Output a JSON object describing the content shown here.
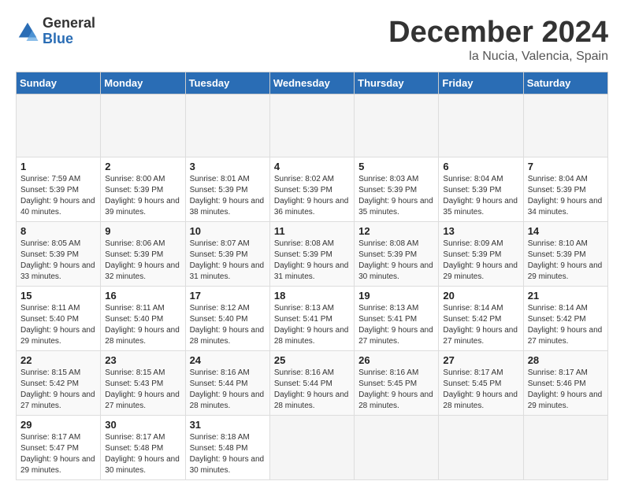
{
  "header": {
    "logo_general": "General",
    "logo_blue": "Blue",
    "month_title": "December 2024",
    "location": "la Nucia, Valencia, Spain"
  },
  "calendar": {
    "days_of_week": [
      "Sunday",
      "Monday",
      "Tuesday",
      "Wednesday",
      "Thursday",
      "Friday",
      "Saturday"
    ],
    "weeks": [
      [
        {
          "day": "",
          "empty": true
        },
        {
          "day": "",
          "empty": true
        },
        {
          "day": "",
          "empty": true
        },
        {
          "day": "",
          "empty": true
        },
        {
          "day": "",
          "empty": true
        },
        {
          "day": "",
          "empty": true
        },
        {
          "day": "",
          "empty": true
        }
      ],
      [
        {
          "day": "1",
          "sunrise": "Sunrise: 7:59 AM",
          "sunset": "Sunset: 5:39 PM",
          "daylight": "Daylight: 9 hours and 40 minutes."
        },
        {
          "day": "2",
          "sunrise": "Sunrise: 8:00 AM",
          "sunset": "Sunset: 5:39 PM",
          "daylight": "Daylight: 9 hours and 39 minutes."
        },
        {
          "day": "3",
          "sunrise": "Sunrise: 8:01 AM",
          "sunset": "Sunset: 5:39 PM",
          "daylight": "Daylight: 9 hours and 38 minutes."
        },
        {
          "day": "4",
          "sunrise": "Sunrise: 8:02 AM",
          "sunset": "Sunset: 5:39 PM",
          "daylight": "Daylight: 9 hours and 36 minutes."
        },
        {
          "day": "5",
          "sunrise": "Sunrise: 8:03 AM",
          "sunset": "Sunset: 5:39 PM",
          "daylight": "Daylight: 9 hours and 35 minutes."
        },
        {
          "day": "6",
          "sunrise": "Sunrise: 8:04 AM",
          "sunset": "Sunset: 5:39 PM",
          "daylight": "Daylight: 9 hours and 35 minutes."
        },
        {
          "day": "7",
          "sunrise": "Sunrise: 8:04 AM",
          "sunset": "Sunset: 5:39 PM",
          "daylight": "Daylight: 9 hours and 34 minutes."
        }
      ],
      [
        {
          "day": "8",
          "sunrise": "Sunrise: 8:05 AM",
          "sunset": "Sunset: 5:39 PM",
          "daylight": "Daylight: 9 hours and 33 minutes."
        },
        {
          "day": "9",
          "sunrise": "Sunrise: 8:06 AM",
          "sunset": "Sunset: 5:39 PM",
          "daylight": "Daylight: 9 hours and 32 minutes."
        },
        {
          "day": "10",
          "sunrise": "Sunrise: 8:07 AM",
          "sunset": "Sunset: 5:39 PM",
          "daylight": "Daylight: 9 hours and 31 minutes."
        },
        {
          "day": "11",
          "sunrise": "Sunrise: 8:08 AM",
          "sunset": "Sunset: 5:39 PM",
          "daylight": "Daylight: 9 hours and 31 minutes."
        },
        {
          "day": "12",
          "sunrise": "Sunrise: 8:08 AM",
          "sunset": "Sunset: 5:39 PM",
          "daylight": "Daylight: 9 hours and 30 minutes."
        },
        {
          "day": "13",
          "sunrise": "Sunrise: 8:09 AM",
          "sunset": "Sunset: 5:39 PM",
          "daylight": "Daylight: 9 hours and 29 minutes."
        },
        {
          "day": "14",
          "sunrise": "Sunrise: 8:10 AM",
          "sunset": "Sunset: 5:39 PM",
          "daylight": "Daylight: 9 hours and 29 minutes."
        }
      ],
      [
        {
          "day": "15",
          "sunrise": "Sunrise: 8:11 AM",
          "sunset": "Sunset: 5:40 PM",
          "daylight": "Daylight: 9 hours and 29 minutes."
        },
        {
          "day": "16",
          "sunrise": "Sunrise: 8:11 AM",
          "sunset": "Sunset: 5:40 PM",
          "daylight": "Daylight: 9 hours and 28 minutes."
        },
        {
          "day": "17",
          "sunrise": "Sunrise: 8:12 AM",
          "sunset": "Sunset: 5:40 PM",
          "daylight": "Daylight: 9 hours and 28 minutes."
        },
        {
          "day": "18",
          "sunrise": "Sunrise: 8:13 AM",
          "sunset": "Sunset: 5:41 PM",
          "daylight": "Daylight: 9 hours and 28 minutes."
        },
        {
          "day": "19",
          "sunrise": "Sunrise: 8:13 AM",
          "sunset": "Sunset: 5:41 PM",
          "daylight": "Daylight: 9 hours and 27 minutes."
        },
        {
          "day": "20",
          "sunrise": "Sunrise: 8:14 AM",
          "sunset": "Sunset: 5:42 PM",
          "daylight": "Daylight: 9 hours and 27 minutes."
        },
        {
          "day": "21",
          "sunrise": "Sunrise: 8:14 AM",
          "sunset": "Sunset: 5:42 PM",
          "daylight": "Daylight: 9 hours and 27 minutes."
        }
      ],
      [
        {
          "day": "22",
          "sunrise": "Sunrise: 8:15 AM",
          "sunset": "Sunset: 5:42 PM",
          "daylight": "Daylight: 9 hours and 27 minutes."
        },
        {
          "day": "23",
          "sunrise": "Sunrise: 8:15 AM",
          "sunset": "Sunset: 5:43 PM",
          "daylight": "Daylight: 9 hours and 27 minutes."
        },
        {
          "day": "24",
          "sunrise": "Sunrise: 8:16 AM",
          "sunset": "Sunset: 5:44 PM",
          "daylight": "Daylight: 9 hours and 28 minutes."
        },
        {
          "day": "25",
          "sunrise": "Sunrise: 8:16 AM",
          "sunset": "Sunset: 5:44 PM",
          "daylight": "Daylight: 9 hours and 28 minutes."
        },
        {
          "day": "26",
          "sunrise": "Sunrise: 8:16 AM",
          "sunset": "Sunset: 5:45 PM",
          "daylight": "Daylight: 9 hours and 28 minutes."
        },
        {
          "day": "27",
          "sunrise": "Sunrise: 8:17 AM",
          "sunset": "Sunset: 5:45 PM",
          "daylight": "Daylight: 9 hours and 28 minutes."
        },
        {
          "day": "28",
          "sunrise": "Sunrise: 8:17 AM",
          "sunset": "Sunset: 5:46 PM",
          "daylight": "Daylight: 9 hours and 29 minutes."
        }
      ],
      [
        {
          "day": "29",
          "sunrise": "Sunrise: 8:17 AM",
          "sunset": "Sunset: 5:47 PM",
          "daylight": "Daylight: 9 hours and 29 minutes."
        },
        {
          "day": "30",
          "sunrise": "Sunrise: 8:17 AM",
          "sunset": "Sunset: 5:48 PM",
          "daylight": "Daylight: 9 hours and 30 minutes."
        },
        {
          "day": "31",
          "sunrise": "Sunrise: 8:18 AM",
          "sunset": "Sunset: 5:48 PM",
          "daylight": "Daylight: 9 hours and 30 minutes."
        },
        {
          "day": "",
          "empty": true
        },
        {
          "day": "",
          "empty": true
        },
        {
          "day": "",
          "empty": true
        },
        {
          "day": "",
          "empty": true
        }
      ]
    ]
  }
}
